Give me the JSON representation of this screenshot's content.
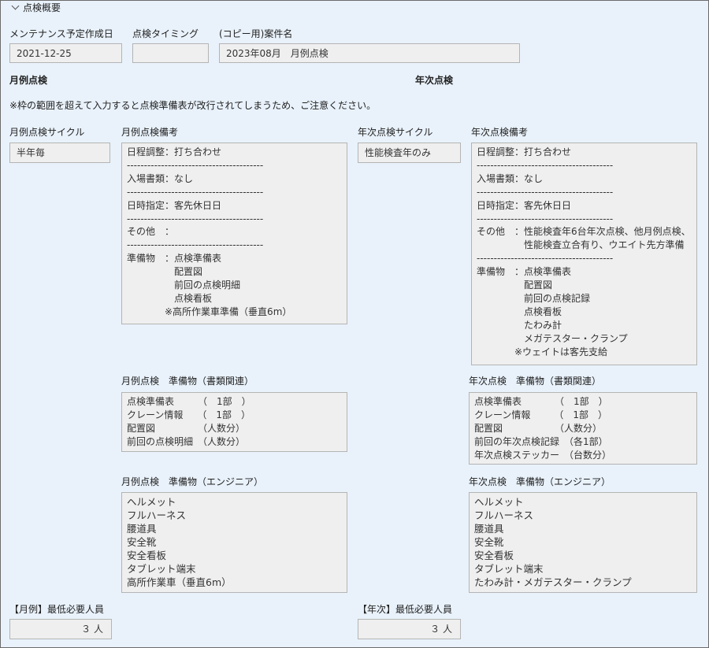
{
  "section": {
    "title": "点検概要"
  },
  "labels": {
    "maint_date": "メンテナンス予定作成日",
    "timing": "点検タイミング",
    "case_name": "(コピー用)案件名",
    "monthly_heading": "月例点検",
    "annual_heading": "年次点検",
    "notice": "※枠の範囲を超えて入力すると点検準備表が改行されてしまうため、ご注意ください。",
    "monthly_cycle": "月例点検サイクル",
    "monthly_remarks": "月例点検備考",
    "annual_cycle": "年次点検サイクル",
    "annual_remarks": "年次点検備考",
    "monthly_docs": "月例点検　準備物（書類関連）",
    "annual_docs": "年次点検　準備物（書類関連）",
    "monthly_eng": "月例点検　準備物（エンジニア）",
    "annual_eng": "年次点検　準備物（エンジニア）",
    "monthly_min": "【月例】最低必要人員",
    "annual_min": "【年次】最低必要人員"
  },
  "values": {
    "maint_date": "2021-12-25",
    "timing": "",
    "case_name": "2023年08月　月例点検",
    "monthly_cycle": "半年毎",
    "annual_cycle": "性能検査年のみ",
    "monthly_remarks": "日程調整：打ち合わせ\n----------------------------------------\n入場書類：なし\n----------------------------------------\n日時指定：客先休日日\n----------------------------------------\nその他　：\n----------------------------------------\n準備物　：点検準備表\n　　　　　配置図\n　　　　　前回の点検明細\n　　　　　点検看板\n　　　　※高所作業車準備（垂直6m）",
    "annual_remarks": "日程調整：打ち合わせ\n----------------------------------------\n入場書類：なし\n----------------------------------------\n日時指定：客先休日日\n----------------------------------------\nその他　：性能検査年6台年次点検、他月例点検、\n　　　　　性能検査立合有り、ウエイト先方準備\n----------------------------------------\n準備物　：点検準備表\n　　　　　配置図\n　　　　　前回の点検記録\n　　　　　点検看板\n　　　　　たわみ計\n　　　　　メガテスター・クランプ\n　　　　※ウェイトは客先支給",
    "monthly_docs": "点検準備表　　　（　1部　）\nクレーン情報　　（　1部　）\n配置図　　　　　（人数分）\n前回の点検明細　（人数分）",
    "annual_docs": "点検準備表　　　　（　1部　）\nクレーン情報　　　（　1部　）\n配置図　　　　　　（人数分）\n前回の年次点検記録　（各1部）\n年次点検ステッカー　（台数分）",
    "monthly_eng": "ヘルメット\nフルハーネス\n腰道具\n安全靴\n安全看板\nタブレット端末\n高所作業車（垂直6m）",
    "annual_eng": "ヘルメット\nフルハーネス\n腰道具\n安全靴\n安全看板\nタブレット端末\nたわみ計・メガテスター・クランプ",
    "monthly_min": "３ 人",
    "annual_min": "３ 人"
  }
}
